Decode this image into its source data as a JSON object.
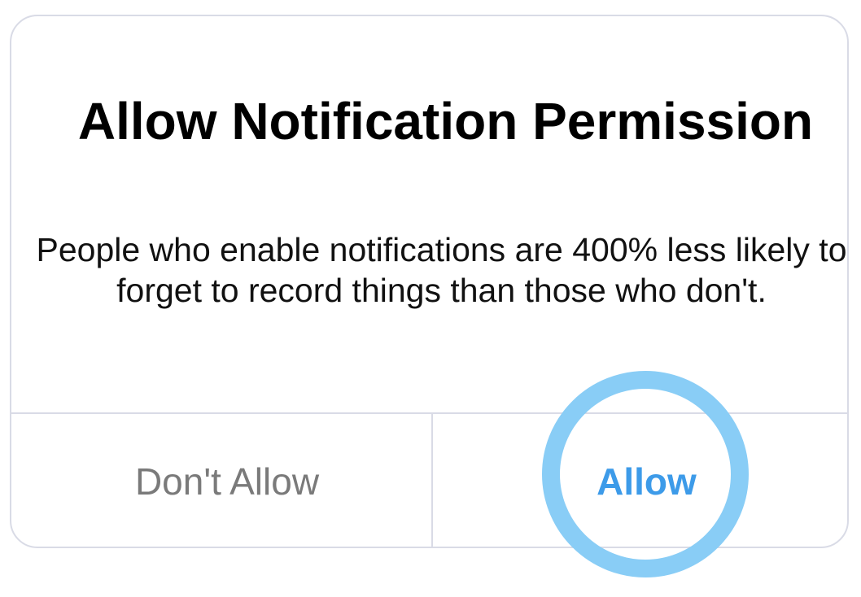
{
  "dialog": {
    "title": "Allow Notification Permission",
    "message": "People who enable notifications are 400% less likely to forget to record things than those who don't.",
    "deny_label": "Don't Allow",
    "allow_label": "Allow"
  },
  "colors": {
    "accent": "#3d9be9",
    "highlight_ring": "#89cdf6",
    "border": "#d9dbe6",
    "deny_text": "#7a7a7a"
  }
}
